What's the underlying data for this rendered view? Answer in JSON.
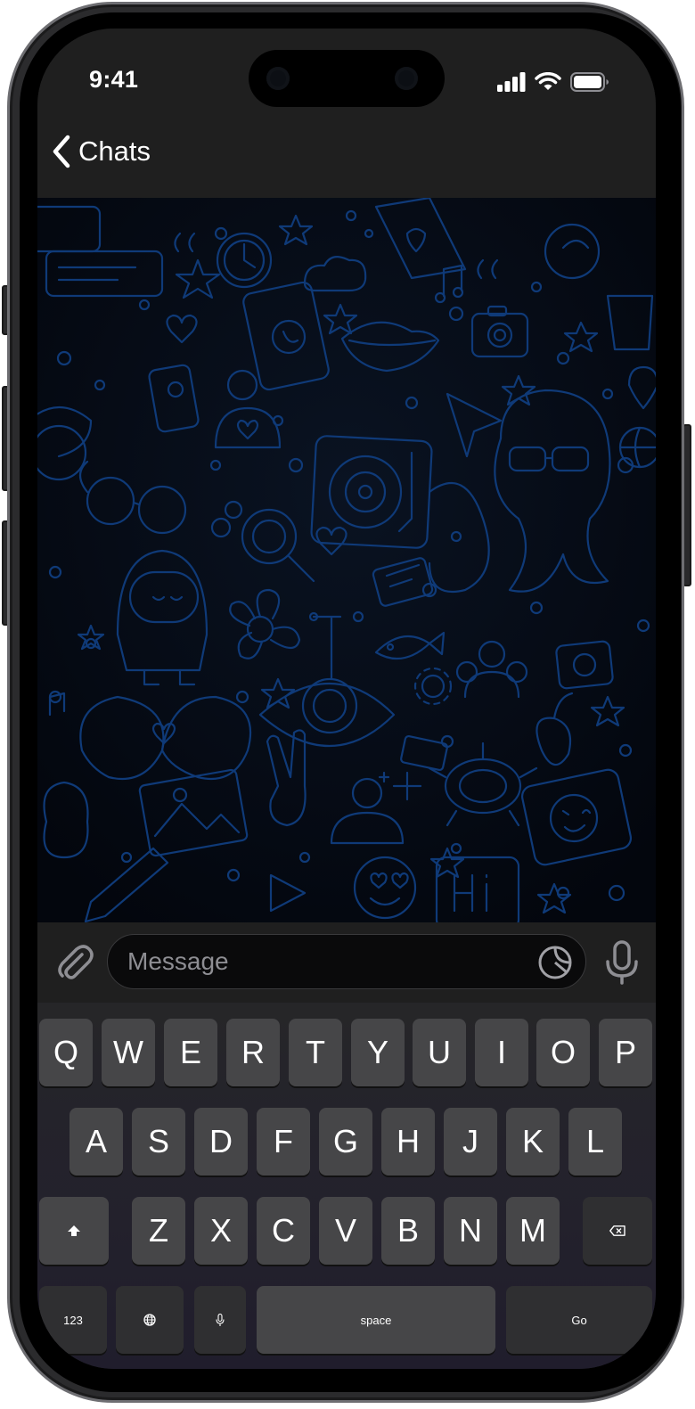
{
  "status_bar": {
    "time": "9:41"
  },
  "nav": {
    "back_label": "Chats"
  },
  "composer": {
    "placeholder": "Message"
  },
  "keyboard": {
    "row1": [
      "Q",
      "W",
      "E",
      "R",
      "T",
      "Y",
      "U",
      "I",
      "O",
      "P"
    ],
    "row2": [
      "A",
      "S",
      "D",
      "F",
      "G",
      "H",
      "J",
      "K",
      "L"
    ],
    "row3": [
      "Z",
      "X",
      "C",
      "V",
      "B",
      "N",
      "M"
    ],
    "numbers_label": "123",
    "space_label": "space",
    "go_label": "Go"
  },
  "colors": {
    "wallpaper_line": "#0f3a78",
    "wallpaper_bg": "#050a14",
    "key_bg": "#464648",
    "key_fn_bg": "#2f2f31"
  }
}
